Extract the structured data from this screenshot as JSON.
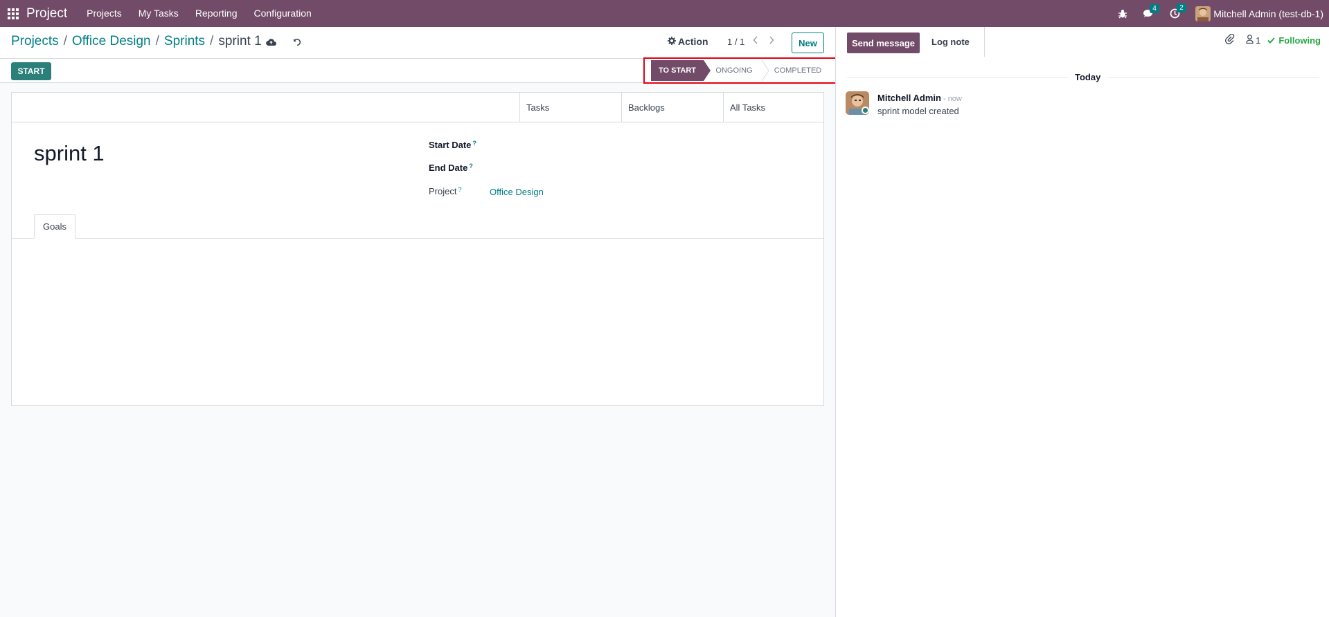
{
  "navbar": {
    "brand": "Project",
    "menu": [
      "Projects",
      "My Tasks",
      "Reporting",
      "Configuration"
    ],
    "messages_count": "4",
    "activities_count": "2",
    "user": "Mitchell Admin (test-db-1)"
  },
  "breadcrumb": {
    "items": [
      "Projects",
      "Office Design",
      "Sprints"
    ],
    "current": "sprint 1",
    "separator": "/"
  },
  "control": {
    "action_label": "Action",
    "pager": "1 / 1",
    "new_label": "New"
  },
  "statusbar": {
    "start_label": "START",
    "stages": [
      "TO START",
      "ONGOING",
      "COMPLETED"
    ],
    "active_stage": "TO START"
  },
  "form": {
    "smart_buttons": [
      "Tasks",
      "Backlogs",
      "All Tasks"
    ],
    "title": "sprint 1",
    "start_date_label": "Start Date",
    "end_date_label": "End Date",
    "project_label": "Project",
    "project_value": "Office Design",
    "help_mark": "?",
    "tabs": [
      "Goals"
    ]
  },
  "chatter": {
    "send_message_label": "Send message",
    "log_note_label": "Log note",
    "followers_count": "1",
    "following_label": "Following",
    "date_separator": "Today",
    "message": {
      "author": "Mitchell Admin",
      "time": "- now",
      "body": "sprint model created"
    }
  },
  "colors": {
    "brand": "#714b67",
    "accent": "#017e84",
    "start_button": "#2b807a",
    "highlight_box": "#e3000f",
    "following": "#28a745"
  }
}
